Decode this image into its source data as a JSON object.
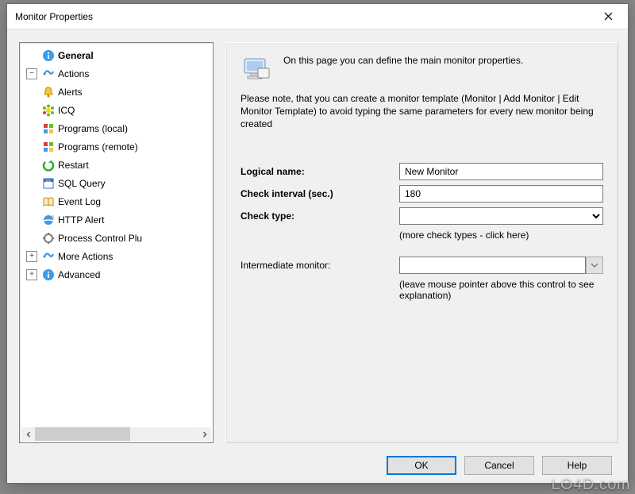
{
  "window": {
    "title": "Monitor Properties"
  },
  "tree": {
    "items": [
      {
        "level": 0,
        "expander": "",
        "icon": "info-icon",
        "label": "General",
        "bold": true
      },
      {
        "level": 0,
        "expander": "minus",
        "icon": "actions-icon",
        "label": "Actions"
      },
      {
        "level": 1,
        "expander": "",
        "icon": "bell-icon",
        "label": "Alerts"
      },
      {
        "level": 1,
        "expander": "",
        "icon": "icq-icon",
        "label": "ICQ"
      },
      {
        "level": 1,
        "expander": "",
        "icon": "windows-icon",
        "label": "Programs (local)"
      },
      {
        "level": 1,
        "expander": "",
        "icon": "windows-icon",
        "label": "Programs (remote)"
      },
      {
        "level": 1,
        "expander": "",
        "icon": "restart-icon",
        "label": "Restart"
      },
      {
        "level": 1,
        "expander": "",
        "icon": "sql-icon",
        "label": "SQL Query"
      },
      {
        "level": 1,
        "expander": "",
        "icon": "book-icon",
        "label": "Event Log"
      },
      {
        "level": 1,
        "expander": "",
        "icon": "ie-icon",
        "label": "HTTP Alert"
      },
      {
        "level": 1,
        "expander": "",
        "icon": "process-icon",
        "label": "Process Control Plu"
      },
      {
        "level": 0,
        "expander": "plus",
        "icon": "actions-icon",
        "label": "More Actions"
      },
      {
        "level": 0,
        "expander": "plus",
        "icon": "info-icon",
        "label": "Advanced"
      }
    ]
  },
  "right": {
    "header_text": "On this page you can define the main monitor properties.",
    "note": "Please note, that you can create a monitor template (Monitor | Add Monitor | Edit Monitor Template) to avoid typing the same parameters for every new monitor being created",
    "logical_name_label": "Logical name:",
    "logical_name_value": "New Monitor",
    "check_interval_label": "Check interval (sec.)",
    "check_interval_value": "180",
    "check_type_label": "Check type:",
    "check_type_value": "",
    "check_type_hint": "(more check types - click here)",
    "intermediate_label": "Intermediate monitor:",
    "intermediate_value": "",
    "intermediate_hint": "(leave mouse pointer above this control to see explanation)"
  },
  "buttons": {
    "ok": "OK",
    "cancel": "Cancel",
    "help": "Help"
  },
  "watermark": "LO4D.com"
}
